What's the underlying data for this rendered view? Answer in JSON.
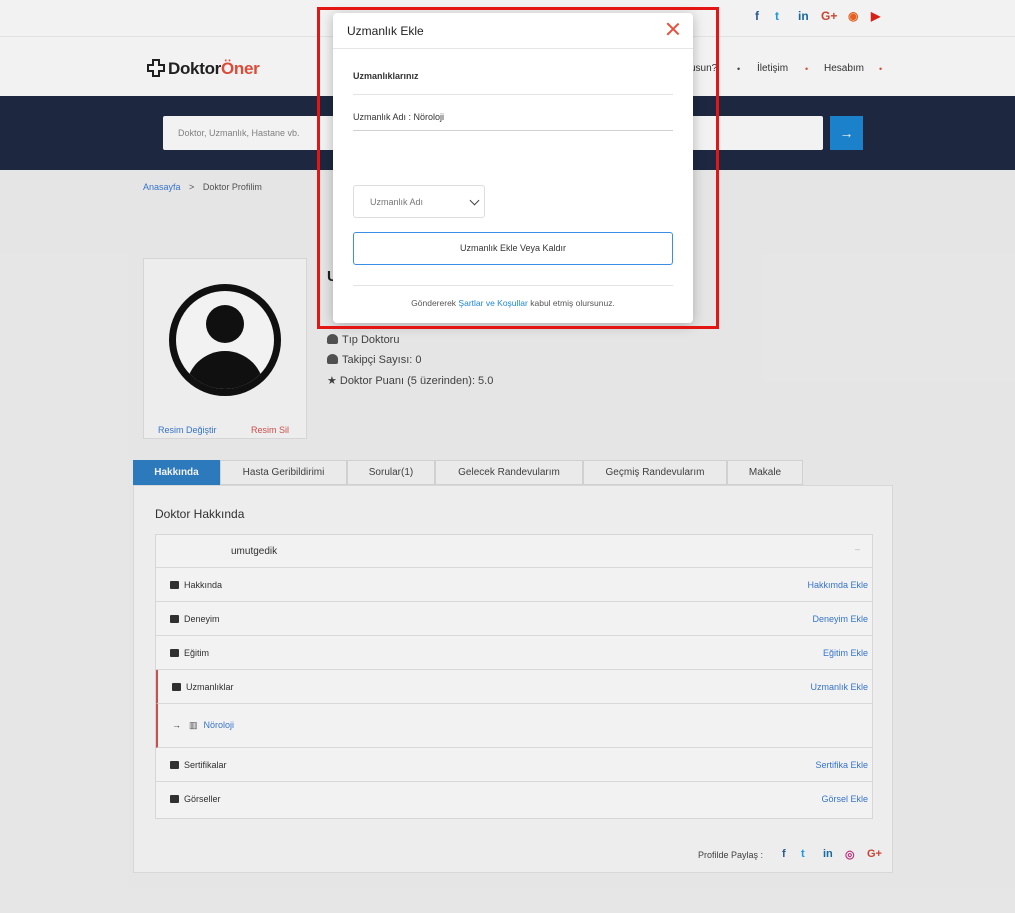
{
  "topbar": {
    "social": [
      {
        "icon": "facebook-icon",
        "glyph": "f",
        "color": "#2d5f9e"
      },
      {
        "icon": "twitter-icon",
        "glyph": "t",
        "color": "#1da1f2"
      },
      {
        "icon": "linkedin-icon",
        "glyph": "in",
        "color": "#1a6fa8"
      },
      {
        "icon": "googleplus-icon",
        "glyph": "G+",
        "color": "#d34836"
      },
      {
        "icon": "rss-icon",
        "glyph": "◉",
        "color": "#f26522"
      },
      {
        "icon": "youtube-icon",
        "glyph": "▶",
        "color": "#e62117"
      }
    ]
  },
  "header": {
    "logo_part1": "Doktor",
    "logo_part2": "Öner",
    "nav": [
      {
        "label": "usun?"
      },
      {
        "label": "İletişim"
      },
      {
        "label": "Hesabım"
      }
    ]
  },
  "search": {
    "placeholder": "Doktor, Uzmanlık, Hastane vb.",
    "button_glyph": "→"
  },
  "breadcrumb": {
    "home": "Anasayfa",
    "separator": ">",
    "current": "Doktor Profilim"
  },
  "profile": {
    "initial": "U",
    "change_photo": "Resim Değiştir",
    "delete_photo": "Resim Sil",
    "title": "Tıp Doktoru",
    "followers": "Takipçi Sayısı: 0",
    "rating": "Doktor Puanı (5 üzerinden): 5.0"
  },
  "tabs": [
    {
      "label": "Hakkında"
    },
    {
      "label": "Hasta Geribildirimi"
    },
    {
      "label": "Sorular(1)"
    },
    {
      "label": "Gelecek Randevularım"
    },
    {
      "label": "Geçmiş Randevularım"
    },
    {
      "label": "Makale"
    }
  ],
  "about": {
    "heading": "Doktor Hakkında",
    "username": "umutgedik",
    "rows": [
      {
        "label": "Hakkında",
        "action": "Hakkımda Ekle"
      },
      {
        "label": "Deneyim",
        "action": "Deneyim Ekle"
      },
      {
        "label": "Eğitim",
        "action": "Eğitim Ekle"
      },
      {
        "label": "Uzmanlıklar",
        "action": "Uzmanlık Ekle"
      },
      {
        "label": "Sertifikalar",
        "action": "Sertifika Ekle"
      },
      {
        "label": "Görseller",
        "action": "Görsel Ekle"
      }
    ],
    "specialty_item": "Nöroloji",
    "share_label": "Profilde Paylaş :"
  },
  "modal": {
    "title": "Uzmanlık Ekle",
    "section_label": "Uzmanlıklarınız",
    "current_specialty": "Uzmanlık Adı : Nöroloji",
    "select_placeholder": "Uzmanlık Adı",
    "submit_label": "Uzmanlık Ekle Veya Kaldır",
    "terms_prefix": "Göndererek",
    "terms_link": "Şartlar ve Koşullar",
    "terms_suffix": "kabul etmiş olursunuz."
  },
  "colors": {
    "accent_blue": "#2f80c7",
    "brand_orange": "#e8503a",
    "highlight_red": "#e41515",
    "navy": "#1f2b44"
  }
}
